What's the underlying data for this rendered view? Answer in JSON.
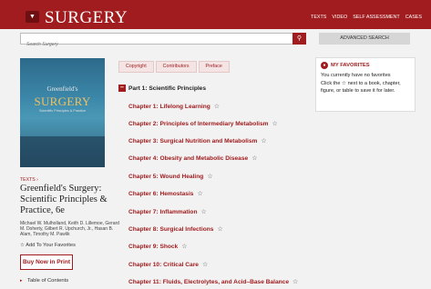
{
  "header": {
    "menu_icon": "chevron-down-icon",
    "brand": "SURGERY",
    "nav": [
      "TEXTS",
      "VIDEO",
      "SELF ASSESSMENT",
      "CASES"
    ]
  },
  "search": {
    "placeholder": "Search Surgery",
    "button_icon": "search-icon",
    "advanced_label": "ADVANCED SEARCH"
  },
  "book": {
    "cover": {
      "top_text": "Greenfield's",
      "title_text": "SURGERY",
      "subtitle_text": "Scientific Principles & Practice"
    },
    "section_label": "TEXTS ›",
    "title": "Greenfield's Surgery: Scientific Principles & Practice, 6e",
    "authors": "Michael W. Mulholland, Keith D. Lillemoe, Gerard M. Doherty, Gilbert R. Upchurch, Jr., Hasan B. Alam, Timothy M. Pawlik",
    "add_favorites_label": "Add To Your Favorites",
    "buy_label": "Buy Now in Print",
    "toc_label": "Table of Contents"
  },
  "tabs": [
    "Copyright",
    "Contributors",
    "Preface"
  ],
  "part": {
    "toggle": "–",
    "label": "Part 1: Scientific Principles"
  },
  "chapters": [
    "Chapter 1: Lifelong Learning",
    "Chapter 2: Principles of Intermediary Metabolism",
    "Chapter 3: Surgical Nutrition and Metabolism",
    "Chapter 4: Obesity and Metabolic Disease",
    "Chapter 5: Wound Healing",
    "Chapter 6: Hemostasis",
    "Chapter 7: Inflammation",
    "Chapter 8: Surgical Infections",
    "Chapter 9: Shock",
    "Chapter 10: Critical Care",
    "Chapter 11: Fluids, Electrolytes, and Acid–Base Balance"
  ],
  "favorites": {
    "icon": "user-icon",
    "heading": "MY FAVORITES",
    "empty_text": "You currently have no favorites",
    "help_text": "Click the ☆ next to a book, chapter, figure, or table to save it for later."
  },
  "colors": {
    "brand": "#a01c1e",
    "background": "#f2f2f2"
  }
}
